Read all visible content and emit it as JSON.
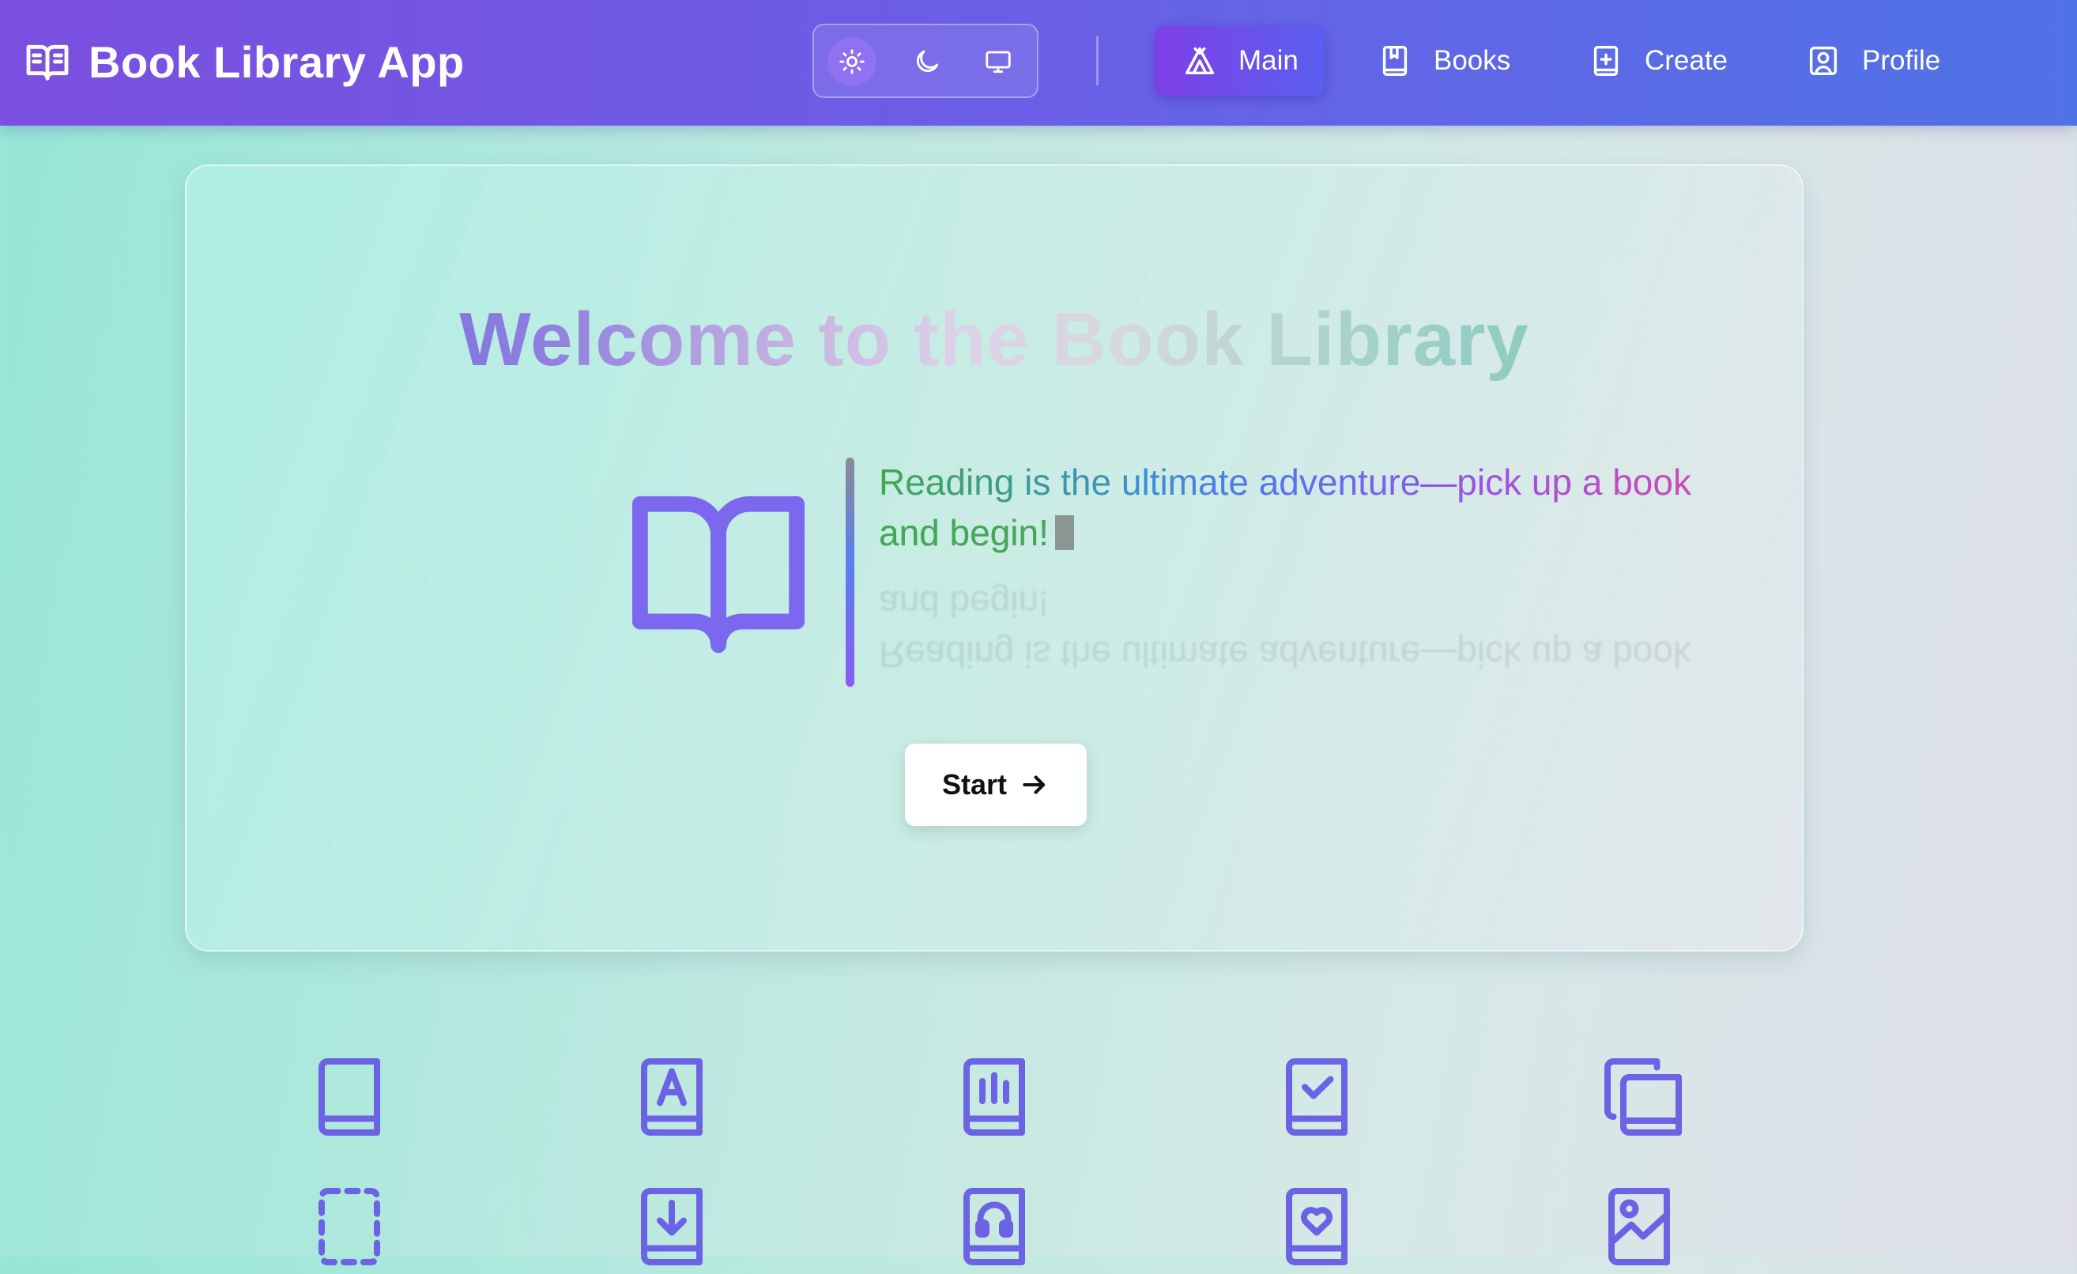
{
  "app": {
    "title": "Book Library App"
  },
  "theme_switch": {
    "options": [
      {
        "icon": "sun-icon",
        "active": true
      },
      {
        "icon": "moon-icon",
        "active": false
      },
      {
        "icon": "monitor-icon",
        "active": false
      }
    ]
  },
  "nav": {
    "items": [
      {
        "label": "Main",
        "icon": "camping-tent-icon",
        "active": true
      },
      {
        "label": "Books",
        "icon": "bookmark-book-icon",
        "active": false
      },
      {
        "label": "Create",
        "icon": "add-book-icon",
        "active": false
      },
      {
        "label": "Profile",
        "icon": "user-profile-icon",
        "active": false
      }
    ]
  },
  "hero": {
    "title": "Welcome to the Book Library",
    "quote_line1": "Reading is the ultimate adventure—pick up a book",
    "quote_line2": "and begin!",
    "button_label": "Start",
    "icon": "open-book-icon"
  },
  "book_icons": [
    "book-icon",
    "book-letter-icon",
    "book-chart-icon",
    "book-check-icon",
    "books-stack-icon",
    "book-dashed-icon",
    "book-download-icon",
    "audiobook-icon",
    "book-heart-icon",
    "book-image-icon"
  ],
  "colors": {
    "header_start": "#7b4fe0",
    "header_end": "#4f73e6",
    "accent": "#6b5ce6",
    "icon_color": "#6b63e4"
  }
}
